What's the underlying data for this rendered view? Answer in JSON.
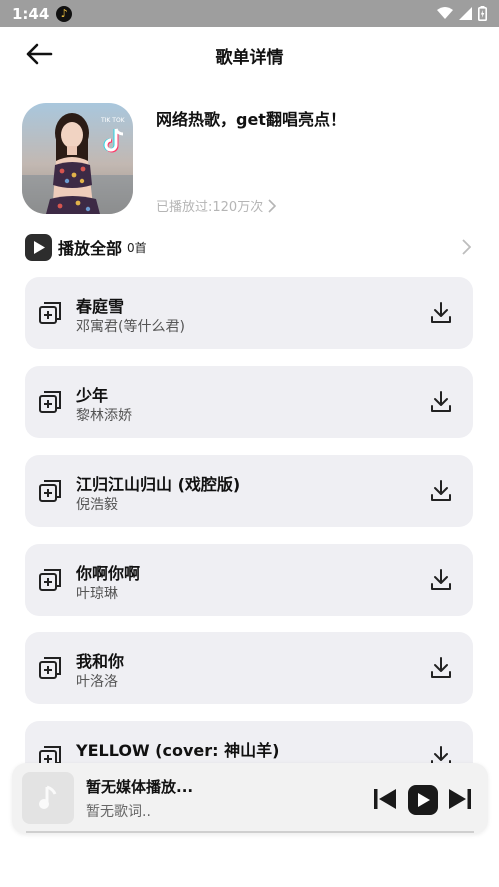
{
  "status_bar": {
    "time": "1:44"
  },
  "header": {
    "title": "歌单详情"
  },
  "playlist": {
    "name": "网络热歌，get翻唱亮点！",
    "play_count": "已播放过:120万次",
    "cover_logo": "TIK TOK"
  },
  "play_all": {
    "label": "播放全部",
    "count": "0首"
  },
  "songs": [
    {
      "title": "春庭雪",
      "artist": "邓寓君(等什么君)"
    },
    {
      "title": "少年",
      "artist": "黎林添娇"
    },
    {
      "title": "江归江山归山 (戏腔版)",
      "artist": "倪浩毅"
    },
    {
      "title": "你啊你啊",
      "artist": "叶琼琳"
    },
    {
      "title": "我和你",
      "artist": "叶洛洛"
    },
    {
      "title": "YELLOW (cover: 神山羊)",
      "artist": ""
    }
  ],
  "player": {
    "title": "暂无媒体播放...",
    "lyric": "暂无歌词.."
  },
  "icons": {
    "back": "arrow-left-icon",
    "play_all": "play-icon",
    "add": "add-to-list-icon",
    "download": "download-icon",
    "prev": "skip-previous-icon",
    "play": "play-icon",
    "next": "skip-next-icon"
  }
}
